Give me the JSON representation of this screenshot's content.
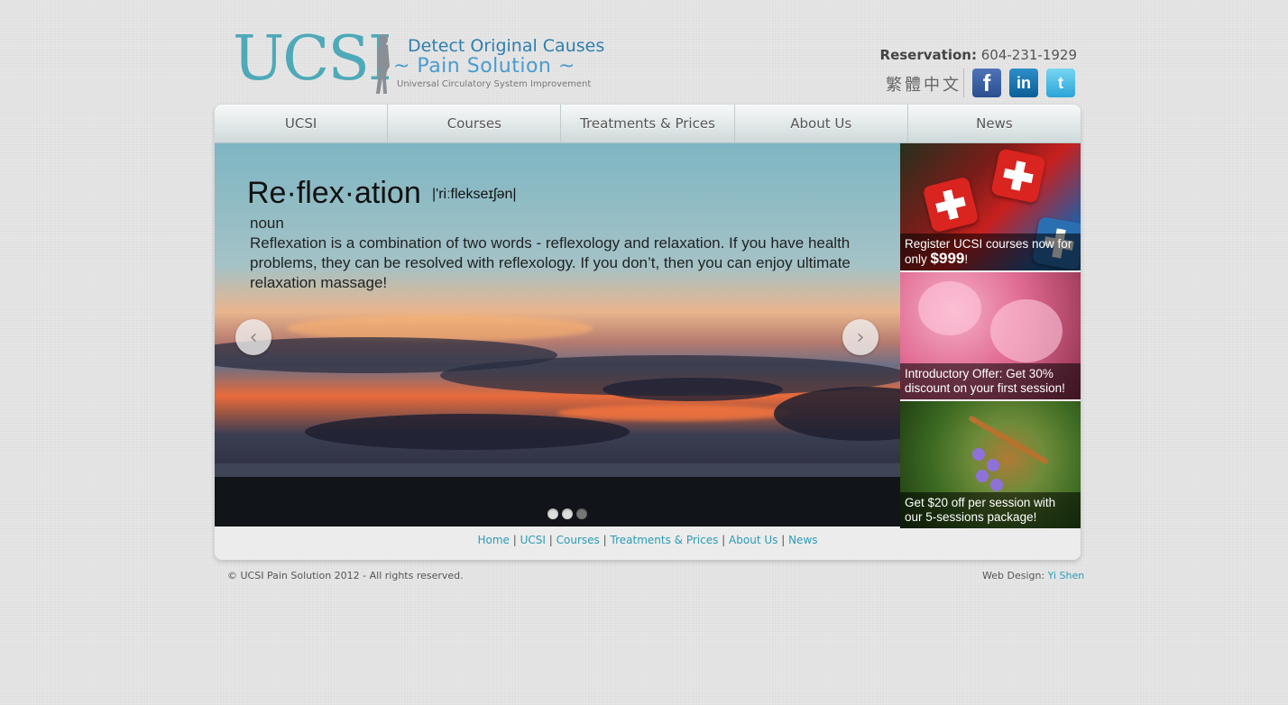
{
  "logo": {
    "brand": "UCSI",
    "tagline1": "Detect Original Causes",
    "tagline2": "~ Pain Solution ~",
    "tagline3": "Universal Circulatory System Improvement"
  },
  "header": {
    "reservation_label": "Reservation:",
    "reservation_phone": "604-231-1929",
    "language_link": "繁體中文",
    "social": [
      {
        "icon": "facebook-icon",
        "glyph": "f"
      },
      {
        "icon": "linkedin-icon",
        "glyph": "in"
      },
      {
        "icon": "twitter-icon",
        "glyph": "t"
      }
    ]
  },
  "nav": {
    "items": [
      {
        "label": "UCSI"
      },
      {
        "label": "Courses"
      },
      {
        "label": "Treatments & Prices"
      },
      {
        "label": "About Us"
      },
      {
        "label": "News"
      }
    ]
  },
  "slide": {
    "word": "Re·flex·ation",
    "pronunciation": "|'riːflekseɪʃən|",
    "part_of_speech": "noun",
    "definition": "Reflexation is a combination of two words - reflexology and relaxation. If you have health problems, they can be resolved with reflexology. If you don’t, then you can enjoy ultimate relaxation massage!",
    "prev_glyph": "‹",
    "next_glyph": "›",
    "slide_count": 3,
    "active_slide": 3
  },
  "promos": [
    {
      "text_before": "Register UCSI courses now for only ",
      "price": "$999",
      "text_after": "!"
    },
    {
      "text": "Introductory Offer: Get 30% discount on your first session!"
    },
    {
      "text": "Get $20 off per session with our 5-sessions package!"
    }
  ],
  "footer": {
    "links": [
      "Home",
      "UCSI",
      "Courses",
      "Treatments & Prices",
      "About Us",
      "News"
    ],
    "separator": "|",
    "copyright": "© UCSI Pain Solution 2012 - All rights reserved.",
    "credit_label": "Web Design:",
    "credit_name": "Yi Shen"
  }
}
